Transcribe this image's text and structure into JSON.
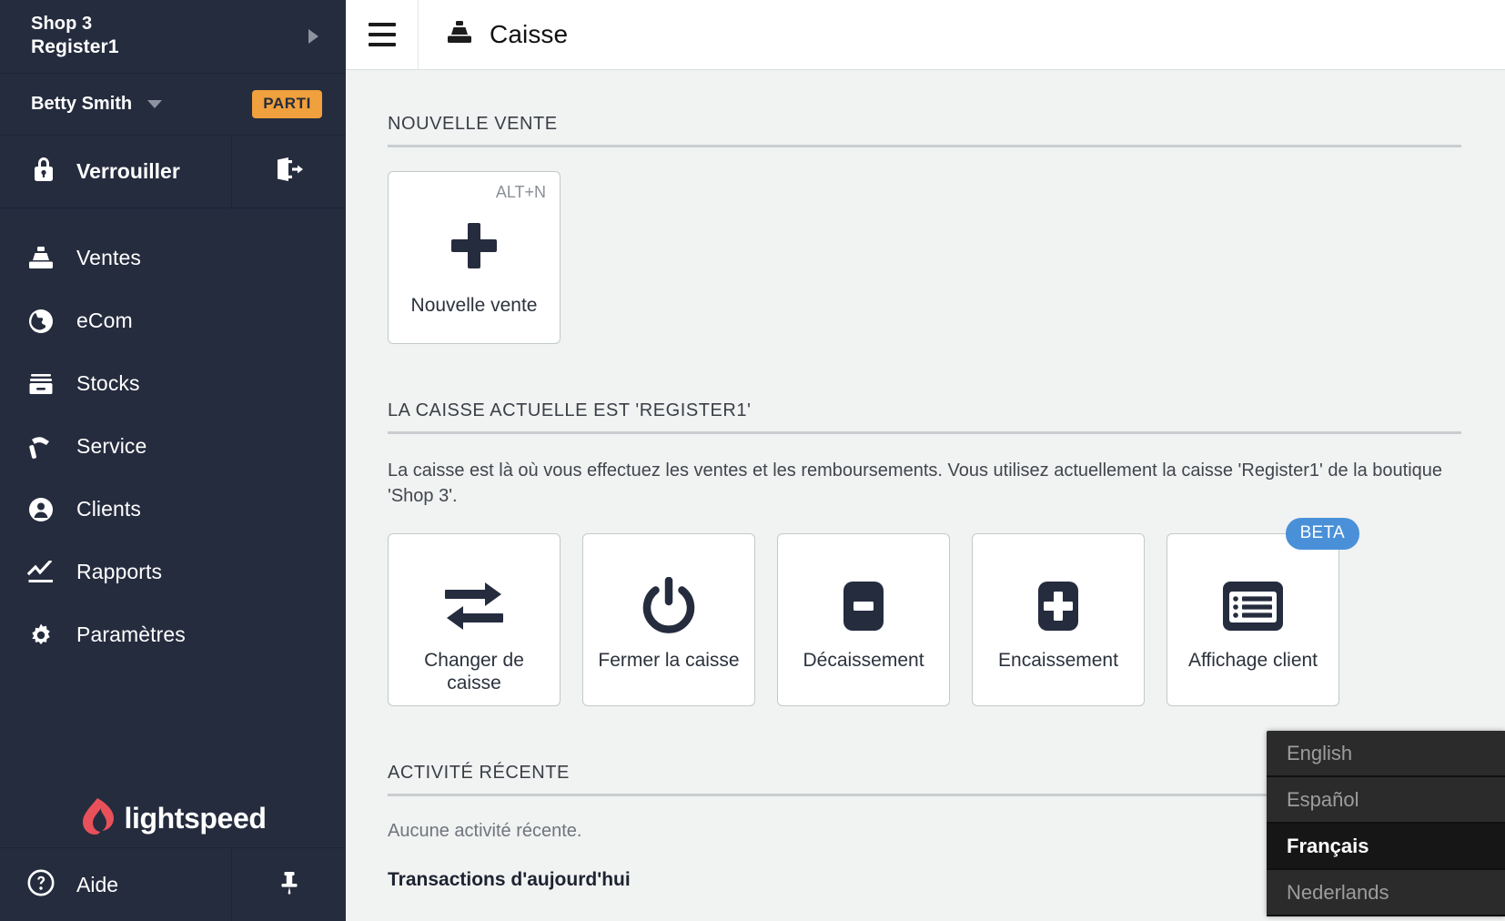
{
  "sidebar": {
    "shop": {
      "shop_name": "Shop 3",
      "register_name": "Register1"
    },
    "user": {
      "name": "Betty Smith",
      "status_badge": "PARTI"
    },
    "lock_label": "Verrouiller",
    "nav_items": [
      {
        "label": "Ventes",
        "icon": "register-icon"
      },
      {
        "label": "eCom",
        "icon": "globe-icon"
      },
      {
        "label": "Stocks",
        "icon": "inventory-icon"
      },
      {
        "label": "Service",
        "icon": "hammer-icon"
      },
      {
        "label": "Clients",
        "icon": "person-icon"
      },
      {
        "label": "Rapports",
        "icon": "chart-icon"
      },
      {
        "label": "Paramètres",
        "icon": "gear-icon"
      }
    ],
    "brand": "lightspeed",
    "help_label": "Aide"
  },
  "header": {
    "title": "Caisse"
  },
  "main": {
    "new_sale": {
      "section_title": "NOUVELLE VENTE",
      "card_label": "Nouvelle vente",
      "shortcut": "ALT+N"
    },
    "register": {
      "section_title": "LA CAISSE ACTUELLE EST 'REGISTER1'",
      "description": "La caisse est là où vous effectuez les ventes et les remboursements. Vous utilisez actuellement la caisse 'Register1' de la boutique 'Shop 3'.",
      "actions": [
        {
          "label": "Changer de caisse",
          "icon": "swap-arrows-icon",
          "badge": ""
        },
        {
          "label": "Fermer la caisse",
          "icon": "power-icon",
          "badge": ""
        },
        {
          "label": "Décaissement",
          "icon": "minus-square-icon",
          "badge": ""
        },
        {
          "label": "Encaissement",
          "icon": "plus-square-icon",
          "badge": ""
        },
        {
          "label": "Affichage client",
          "icon": "list-display-icon",
          "badge": "BETA"
        }
      ]
    },
    "activity": {
      "section_title": "ACTIVITÉ RÉCENTE",
      "empty_text": "Aucune activité récente.",
      "subtitle": "Transactions d'aujourd'hui"
    }
  },
  "language_menu": {
    "items": [
      {
        "label": "English",
        "selected": false
      },
      {
        "label": "Español",
        "selected": false
      },
      {
        "label": "Français",
        "selected": true
      },
      {
        "label": "Nederlands",
        "selected": false
      }
    ]
  },
  "colors": {
    "sidebar_bg": "#252c3e",
    "accent_orange": "#f0a03c",
    "beta_blue": "#4a90d9",
    "brand_red": "#e8515a",
    "icon_dark": "#252c3e"
  }
}
